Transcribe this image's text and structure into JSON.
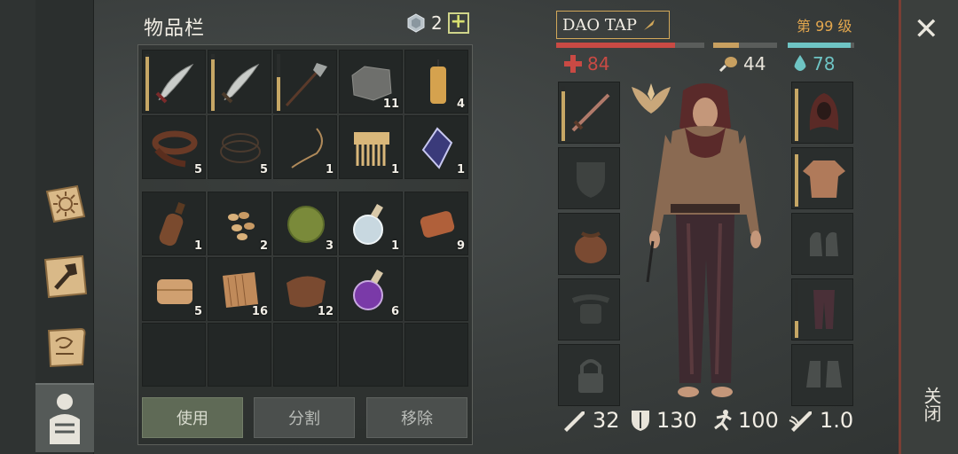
{
  "inventory": {
    "title": "物品栏",
    "gem_count": "2",
    "plus_label": "+",
    "rows_top": [
      {
        "name": "scimitar-1",
        "count": "",
        "durability": 0.95
      },
      {
        "name": "scimitar-2",
        "count": "",
        "durability": 0.9
      },
      {
        "name": "halberd",
        "count": "",
        "durability": 0.6
      },
      {
        "name": "stone",
        "count": "11"
      },
      {
        "name": "candle",
        "count": "4"
      },
      {
        "name": "leather-belt",
        "count": "5"
      },
      {
        "name": "rope",
        "count": "5"
      },
      {
        "name": "cord",
        "count": "1"
      },
      {
        "name": "comb",
        "count": "1"
      },
      {
        "name": "crystal",
        "count": "1"
      }
    ],
    "rows_bottom": [
      {
        "name": "bottle",
        "count": "1"
      },
      {
        "name": "seeds",
        "count": "2"
      },
      {
        "name": "herb-ball",
        "count": "3"
      },
      {
        "name": "potion-clear",
        "count": "1"
      },
      {
        "name": "copper-ingot",
        "count": "9"
      },
      {
        "name": "cloth",
        "count": "5"
      },
      {
        "name": "fabric",
        "count": "16"
      },
      {
        "name": "leather",
        "count": "12"
      },
      {
        "name": "potion-purple",
        "count": "6"
      },
      {
        "name": "empty",
        "count": ""
      }
    ],
    "buttons": {
      "use": "使用",
      "split": "分割",
      "remove": "移除"
    }
  },
  "character": {
    "name": "DAO TAP",
    "level": "第 99 级",
    "health": "84",
    "hunger": "44",
    "thirst": "78",
    "health_fill": 0.8,
    "hunger_fill": 0.4,
    "thirst_fill": 0.95,
    "attack": "32",
    "armor": "130",
    "speed": "100",
    "attack_speed": "1.0",
    "colors": {
      "health": "#c94a44",
      "hunger": "#c8a060",
      "thirst": "#6ec4c4",
      "gold": "#e3a74e"
    }
  },
  "close": {
    "label": "关闭"
  }
}
